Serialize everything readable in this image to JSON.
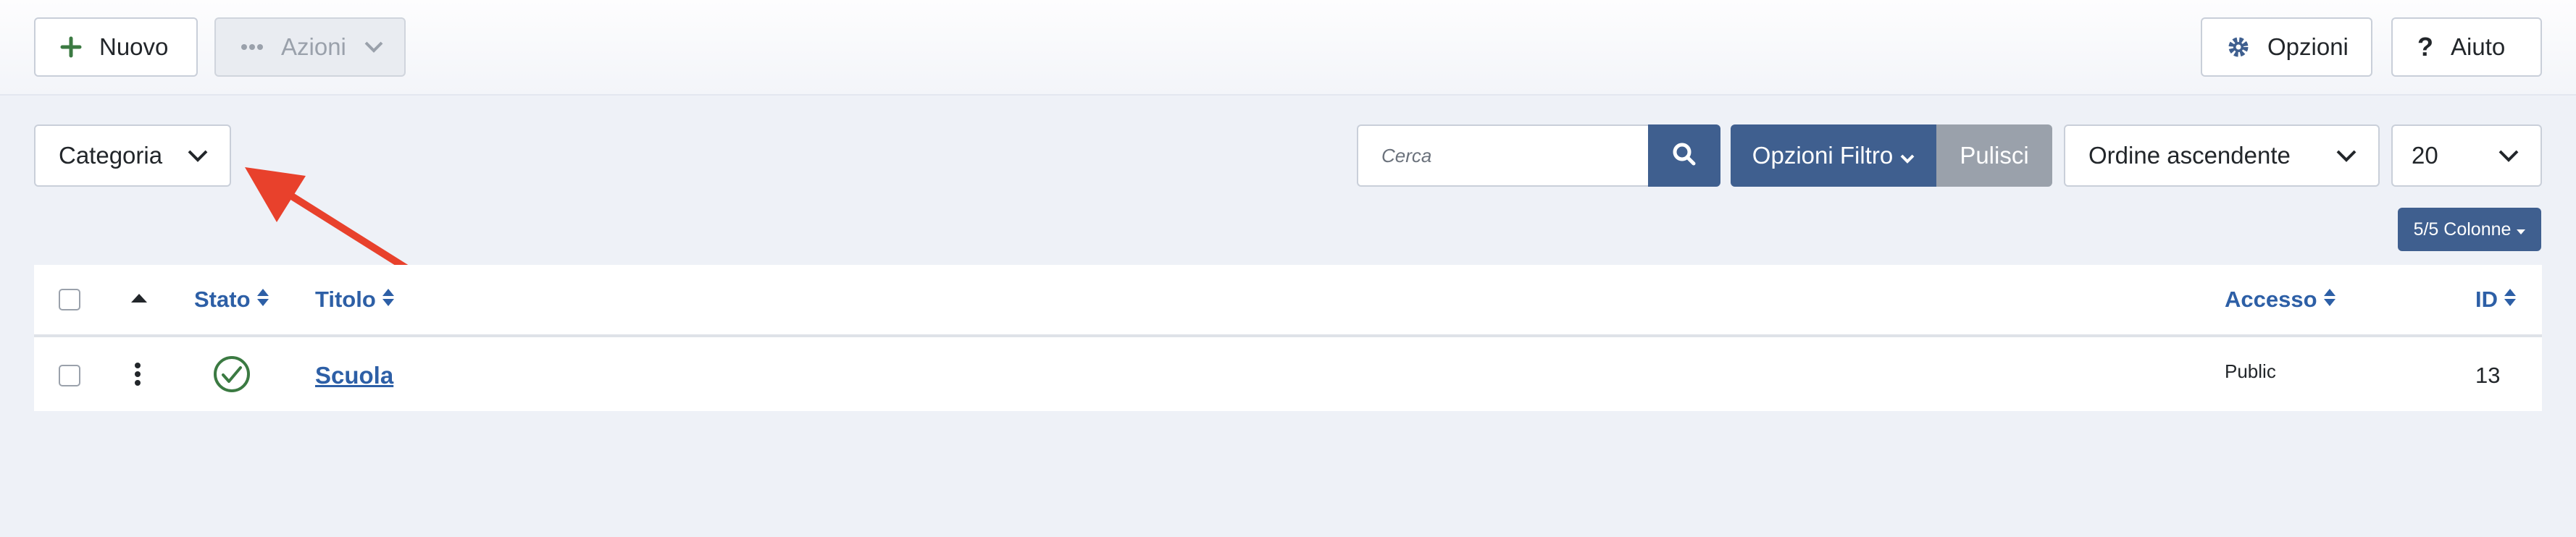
{
  "toolbar": {
    "new_label": "Nuovo",
    "actions_label": "Azioni",
    "options_label": "Opzioni",
    "help_label": "Aiuto"
  },
  "filters": {
    "category_label": "Categoria",
    "search_placeholder": "Cerca",
    "filter_options_label": "Opzioni Filtro",
    "clear_label": "Pulisci",
    "ordering_label": "Ordine ascendente",
    "limit_label": "20",
    "columns_label": "5/5 Colonne"
  },
  "table": {
    "headers": {
      "status": "Stato",
      "title": "Titolo",
      "access": "Accesso",
      "id": "ID"
    },
    "rows": [
      {
        "title": "Scuola",
        "access": "Public",
        "id": "13",
        "status": "published"
      }
    ]
  },
  "colors": {
    "accent": "#3f5f8f",
    "link": "#2d5fa6",
    "published": "#3b7a42",
    "clear_button": "#9aa1ab",
    "annotation_arrow": "#e8412c"
  }
}
